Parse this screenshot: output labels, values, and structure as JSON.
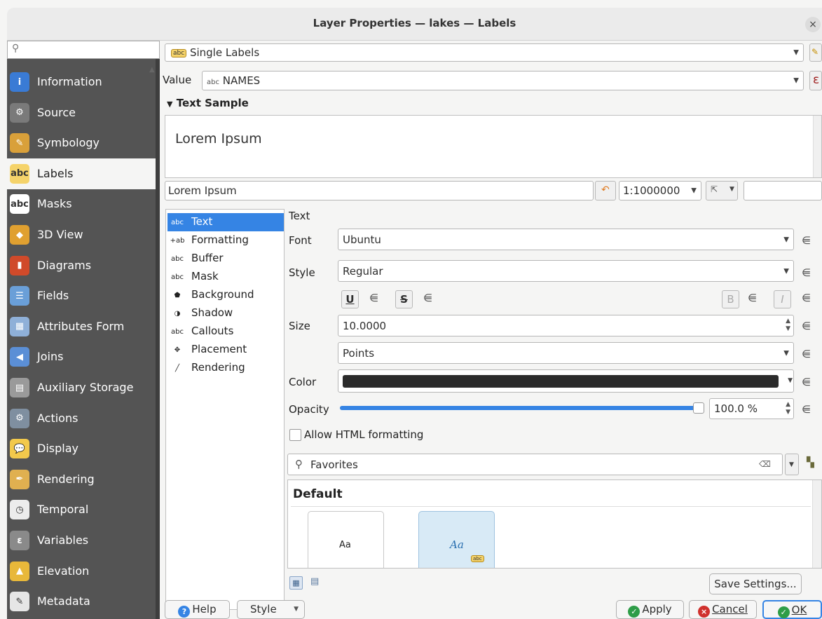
{
  "window": {
    "title": "Layer Properties — lakes — Labels",
    "close_glyph": "×"
  },
  "sidebar": {
    "search_glyph": "⚲",
    "items": [
      {
        "label": "Information",
        "icon": "information-icon",
        "color": "#3a7bd5",
        "glyph": "i"
      },
      {
        "label": "Source",
        "icon": "source-icon",
        "color": "#7a7a7a",
        "glyph": "⚙"
      },
      {
        "label": "Symbology",
        "icon": "symbology-icon",
        "color": "#d9a03a",
        "glyph": "✎"
      },
      {
        "label": "Labels",
        "icon": "labels-icon",
        "color": "#f5d36a",
        "glyph": "abc"
      },
      {
        "label": "Masks",
        "icon": "masks-icon",
        "color": "#ffffff",
        "glyph": "abc"
      },
      {
        "label": "3D View",
        "icon": "cube-icon",
        "color": "#e0a030",
        "glyph": "◆"
      },
      {
        "label": "Diagrams",
        "icon": "diagrams-icon",
        "color": "#d04a2a",
        "glyph": "▮"
      },
      {
        "label": "Fields",
        "icon": "fields-icon",
        "color": "#6a9fd8",
        "glyph": "☰"
      },
      {
        "label": "Attributes Form",
        "icon": "attributes-form-icon",
        "color": "#8fb0d8",
        "glyph": "▦"
      },
      {
        "label": "Joins",
        "icon": "joins-icon",
        "color": "#5b8fd6",
        "glyph": "◀"
      },
      {
        "label": "Auxiliary Storage",
        "icon": "auxiliary-storage-icon",
        "color": "#9a9a9a",
        "glyph": "▤"
      },
      {
        "label": "Actions",
        "icon": "actions-icon",
        "color": "#7f8fa0",
        "glyph": "⚙"
      },
      {
        "label": "Display",
        "icon": "display-icon",
        "color": "#f2c94c",
        "glyph": "💬"
      },
      {
        "label": "Rendering",
        "icon": "rendering-icon",
        "color": "#e0b050",
        "glyph": "✒"
      },
      {
        "label": "Temporal",
        "icon": "temporal-icon",
        "color": "#ececec",
        "glyph": "◷"
      },
      {
        "label": "Variables",
        "icon": "variables-icon",
        "color": "#8a8a8a",
        "glyph": "ε"
      },
      {
        "label": "Elevation",
        "icon": "elevation-icon",
        "color": "#e8b83a",
        "glyph": "▲"
      },
      {
        "label": "Metadata",
        "icon": "metadata-icon",
        "color": "#e6e6e6",
        "glyph": "✎"
      }
    ]
  },
  "mode": {
    "label": "Single Labels",
    "badge": "abc"
  },
  "value": {
    "label": "Value",
    "badge": "abc",
    "field": "NAMES",
    "expr": "ε"
  },
  "text_sample": {
    "header": "Text Sample",
    "preview": "Lorem Ipsum",
    "input": "Lorem Ipsum",
    "scale": "1:1000000"
  },
  "tree": [
    {
      "label": "Text",
      "icon": "text-icon",
      "badge": "abc"
    },
    {
      "label": "Formatting",
      "icon": "formatting-icon",
      "badge": "+ab"
    },
    {
      "label": "Buffer",
      "icon": "buffer-icon",
      "badge": "abc"
    },
    {
      "label": "Mask",
      "icon": "mask-icon",
      "badge": "abc"
    },
    {
      "label": "Background",
      "icon": "background-icon",
      "badge": "⬟"
    },
    {
      "label": "Shadow",
      "icon": "shadow-icon",
      "badge": "◑"
    },
    {
      "label": "Callouts",
      "icon": "callouts-icon",
      "badge": "abc"
    },
    {
      "label": "Placement",
      "icon": "placement-icon",
      "badge": "✥"
    },
    {
      "label": "Rendering",
      "icon": "rendering-brush-icon",
      "badge": "╱"
    }
  ],
  "text_panel": {
    "section": "Text",
    "font_label": "Font",
    "font_value": "Ubuntu",
    "style_label": "Style",
    "style_value": "Regular",
    "size_label": "Size",
    "size_value": "10.0000",
    "unit_value": "Points",
    "color_label": "Color",
    "color_value": "#2b2b2b",
    "opacity_label": "Opacity",
    "opacity_value": "100.0 %",
    "opacity_fraction": 1.0,
    "html_label": "Allow HTML formatting",
    "underline": "U",
    "strike": "S",
    "bold": "B",
    "italic": "I"
  },
  "styles": {
    "search_value": "Favorites",
    "group": "Default",
    "card1_text": "Aa",
    "card2_text": "Aa",
    "card2_badge": "abc",
    "save_settings": "Save Settings..."
  },
  "footer": {
    "help": "Help",
    "style": "Style",
    "apply": "Apply",
    "cancel": "Cancel",
    "ok": "OK"
  }
}
